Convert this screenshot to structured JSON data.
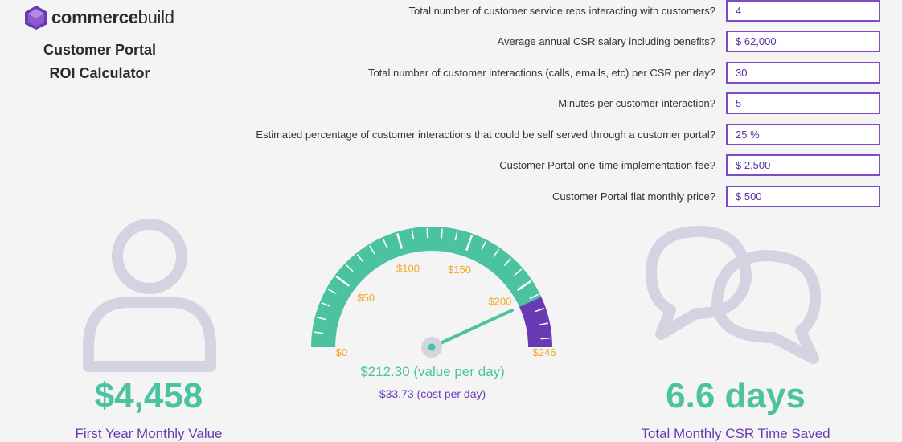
{
  "brand": {
    "name_bold": "commerce",
    "name_light": "build"
  },
  "header": {
    "title_line1": "Customer Portal",
    "title_line2": "ROI Calculator"
  },
  "questions": [
    {
      "label": "Total number of customer service reps interacting with customers?",
      "value": "4"
    },
    {
      "label": "Average annual CSR salary including benefits?",
      "value": "$ 62,000"
    },
    {
      "label": "Total number of customer interactions (calls, emails, etc) per CSR per day?",
      "value": "30"
    },
    {
      "label": "Minutes per customer interaction?",
      "value": "5"
    },
    {
      "label": "Estimated percentage of customer interactions that could be self served through a customer portal?",
      "value": "25 %"
    },
    {
      "label": "Customer Portal one-time implementation fee?",
      "value": "$ 2,500"
    },
    {
      "label": "Customer Portal flat monthly price?",
      "value": "$ 500"
    }
  ],
  "results": {
    "first_year_value": "$4,458",
    "first_year_label": "First Year Monthly Value",
    "time_saved": "6.6 days",
    "time_saved_label": "Total Monthly CSR Time Saved"
  },
  "gauge": {
    "min": 0,
    "max": 246,
    "value": 212.3,
    "cost": 33.73,
    "tick_labels": [
      "$0",
      "$50",
      "$100",
      "$150",
      "$200",
      "$246"
    ],
    "value_text": "$212.30 (value per day)",
    "cost_text": "$33.73 (cost per day)"
  },
  "colors": {
    "accent_green": "#4cc3a0",
    "accent_purple": "#6a3ab5",
    "label_orange": "#f5a623",
    "icon_gray": "#d3d3e2"
  },
  "icons": {
    "person": "person-icon",
    "chat": "chat-bubbles-icon",
    "logo": "cube-logo-icon"
  }
}
